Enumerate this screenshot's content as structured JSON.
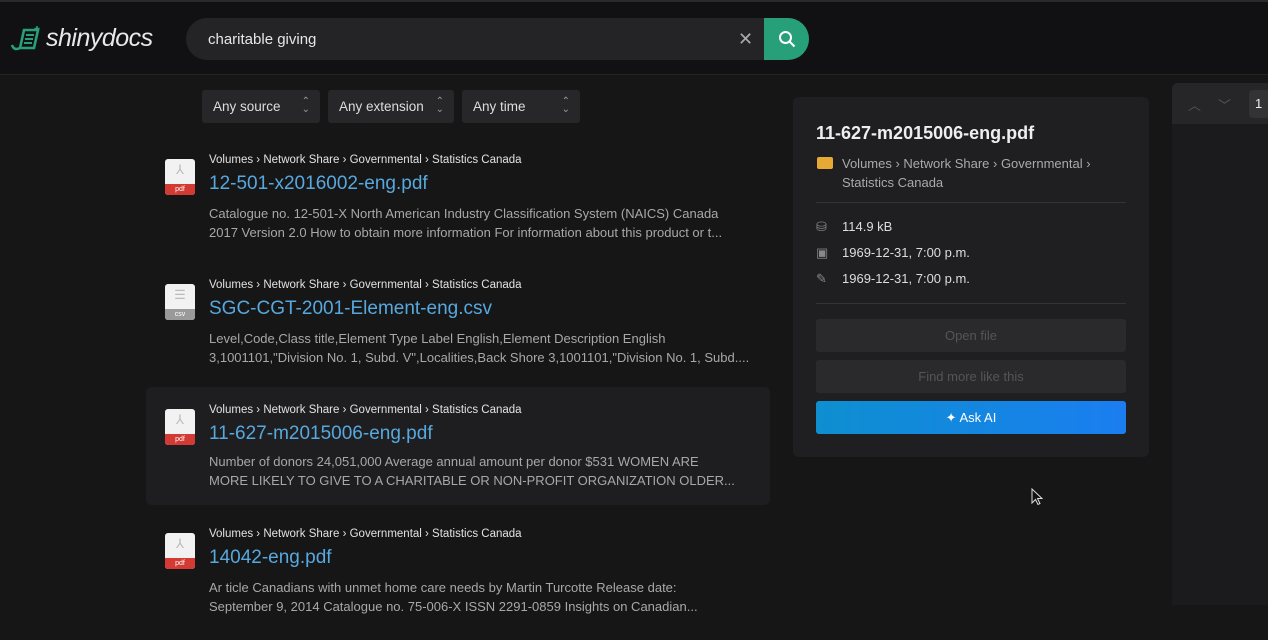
{
  "app": {
    "logo_text": "shinydocs",
    "accent": "#27a07a"
  },
  "search": {
    "value": "charitable giving",
    "clear_icon": "close-icon",
    "submit_icon": "search-icon"
  },
  "filters": [
    {
      "label": "Any source"
    },
    {
      "label": "Any extension"
    },
    {
      "label": "Any time"
    }
  ],
  "results": [
    {
      "type": "pdf",
      "breadcrumb": "Volumes › Network Share › Governmental › Statistics Canada",
      "name": "12-501-x2016002-eng.pdf",
      "snippet": [
        "Catalogue no. 12-501-X North American Industry Classification System (NAICS) Canada",
        "2017 Version 2.0 How to obtain more information For information about this product or t..."
      ]
    },
    {
      "type": "csv",
      "breadcrumb": "Volumes › Network Share › Governmental › Statistics Canada",
      "name": "SGC-CGT-2001-Element-eng.csv",
      "snippet": [
        "Level,Code,Class title,Element Type Label English,Element Description English",
        "3,1001101,\"Division No. 1, Subd. V\",Localities,Back Shore 3,1001101,\"Division No. 1, Subd...."
      ]
    },
    {
      "type": "pdf",
      "selected": true,
      "breadcrumb": "Volumes › Network Share › Governmental › Statistics Canada",
      "name": "11-627-m2015006-eng.pdf",
      "snippet": [
        "Number of donors 24,051,000 Average annual amount per donor $531 WOMEN ARE",
        "MORE LIKELY TO GIVE TO A CHARITABLE OR NON-PROFIT ORGANIZATION OLDER..."
      ]
    },
    {
      "type": "pdf",
      "breadcrumb": "Volumes › Network Share › Governmental › Statistics Canada",
      "name": "14042-eng.pdf",
      "snippet": [
        "Ar ticle Canadians with unmet home care needs by Martin Turcotte Release date:",
        "September 9, 2014 Catalogue no. 75-006-X ISSN 2291-0859 Insights on Canadian..."
      ]
    }
  ],
  "details": {
    "title": "11-627-m2015006-eng.pdf",
    "path": "Volumes › Network Share › Governmental › Statistics Canada",
    "size": "114.9 kB",
    "created": "1969-12-31, 7:00 p.m.",
    "modified": "1969-12-31, 7:00 p.m.",
    "open_label": "Open file",
    "more_label": "Find more like this",
    "ai_label": "Ask AI"
  },
  "viewer": {
    "page": "1"
  }
}
